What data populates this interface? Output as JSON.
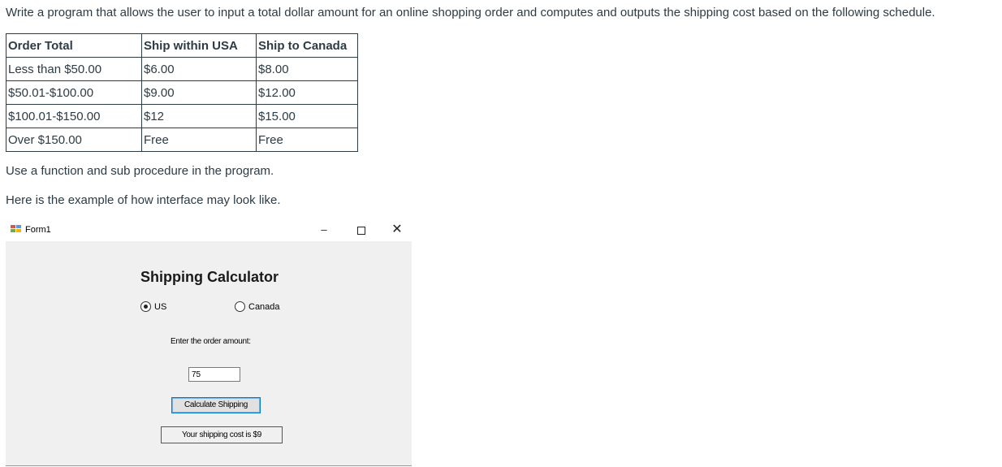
{
  "instructions": {
    "intro": "Write a program that allows the user to input a total dollar amount for an online shopping order and computes and outputs the shipping cost based on the following schedule.",
    "function_note": "Use a function and sub procedure in the program.",
    "example_note": "Here is the example of how interface may look like."
  },
  "schedule": {
    "headers": [
      "Order Total",
      "Ship within USA",
      "Ship to Canada"
    ],
    "rows": [
      [
        "Less than $50.00",
        "$6.00",
        "$8.00"
      ],
      [
        "$50.01-$100.00",
        "$9.00",
        "$12.00"
      ],
      [
        "$100.01-$150.00",
        "$12",
        "$15.00"
      ],
      [
        "Over $150.00",
        "Free",
        "Free"
      ]
    ]
  },
  "form": {
    "window_title": "Form1",
    "minimize_glyph": "–",
    "close_glyph": "✕",
    "heading": "Shipping Calculator",
    "radio_us_label": "US",
    "radio_canada_label": "Canada",
    "selected_destination": "US",
    "amount_prompt": "Enter the order amount:",
    "amount_value": "75",
    "calc_button_label": "Calculate Shipping",
    "result_text": "Your shipping cost is $9",
    "icon": "form-app-icon"
  }
}
